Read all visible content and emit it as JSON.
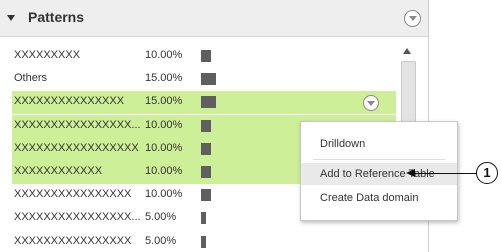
{
  "panel": {
    "title": "Patterns"
  },
  "rows": [
    {
      "label": "XXXXXXXXX",
      "pct": "10.00%",
      "value": 10.0,
      "selected": false
    },
    {
      "label": "Others",
      "pct": "15.00%",
      "value": 15.0,
      "selected": false
    },
    {
      "label": "XXXXXXXXXXXXXXX",
      "pct": "15.00%",
      "value": 15.0,
      "selected": true
    },
    {
      "label": "XXXXXXXXXXXXXXXX...",
      "pct": "10.00%",
      "value": 10.0,
      "selected": true
    },
    {
      "label": "XXXXXXXXXXXXXXXXX",
      "pct": "10.00%",
      "value": 10.0,
      "selected": true
    },
    {
      "label": "XXXXXXXXXXXX",
      "pct": "10.00%",
      "value": 10.0,
      "selected": true
    },
    {
      "label": "XXXXXXXXXXXXXXXX",
      "pct": "10.00%",
      "value": 10.0,
      "selected": false
    },
    {
      "label": "XXXXXXXXXXXXXXXX...",
      "pct": "5.00%",
      "value": 5.0,
      "selected": false
    },
    {
      "label": "XXXXXXXXXXXXXXXX",
      "pct": "5.00%",
      "value": 5.0,
      "selected": false
    }
  ],
  "context_menu": {
    "items": [
      "Drilldown",
      "Add to Reference Table",
      "Create Data domain"
    ],
    "highlighted": "Add to Reference Table"
  },
  "callout": {
    "number": "1"
  },
  "colors": {
    "selected_row": "#cdef98",
    "bar": "#5f5f5f",
    "header": "#eeeeee"
  }
}
